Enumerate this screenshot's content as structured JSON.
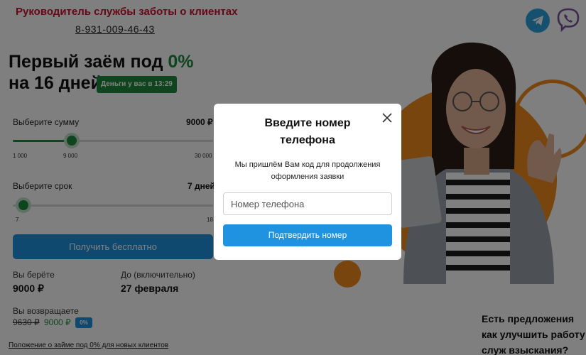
{
  "header": {
    "title": "Руководитель службы заботы о клиентах",
    "phone": "8-931-009-46-43",
    "icons": [
      "telegram-icon",
      "viber-icon"
    ]
  },
  "hero": {
    "headline_prefix": "Первый заём под ",
    "headline_accent": "0%",
    "headline_line2": "на 16 дней",
    "badge": "Деньги у вас в 13:29"
  },
  "calculator": {
    "amount": {
      "label": "Выберите сумму",
      "value": "9000 ₽",
      "min": "1 000",
      "current": "9 000",
      "max": "30 000",
      "fraction": 0.276
    },
    "term": {
      "label": "Выберите срок",
      "value": "7 дней",
      "min": "7",
      "max": "18",
      "fraction": 0.0
    },
    "submit_label": "Получить бесплатно",
    "summary": {
      "take_label": "Вы берёте",
      "take_value": "9000 ₽",
      "until_label": "До (включительно)",
      "until_value": "27 февраля",
      "return_label": "Вы возвращаете",
      "old_price": "9630 ₽",
      "new_price": "9000 ₽",
      "discount_badge": "0%"
    },
    "footer_link": "Положение о займе под 0% для новых клиентов"
  },
  "info_card": {
    "text": "Есть предложения как улучшить работу служ взыскания?"
  },
  "modal": {
    "title": "Введите номер телефона",
    "text": "Мы пришлём Вам код для продолжения оформления заявки",
    "phone_placeholder": "Номер телефона",
    "confirm_label": "Подтвердить номер"
  },
  "colors": {
    "accent_green": "#1e8a3c",
    "brand_blue": "#1f93e0",
    "header_red": "#c8102e",
    "decor_orange": "#f08a1c"
  }
}
